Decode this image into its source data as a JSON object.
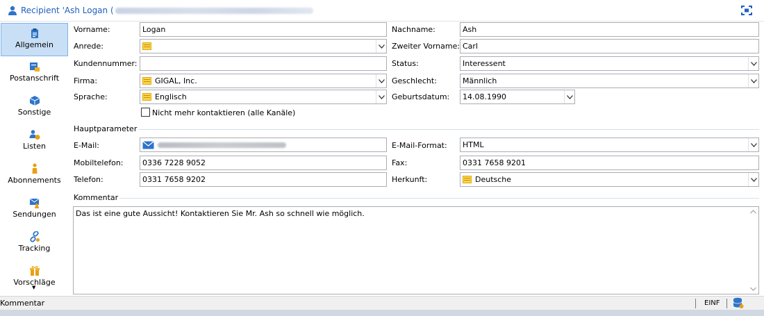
{
  "window": {
    "title": "Recipient 'Ash Logan ("
  },
  "sidebar": {
    "items": [
      {
        "label": "Allgemein",
        "icon": "clipboard-icon"
      },
      {
        "label": "Postanschrift",
        "icon": "mailbox-icon"
      },
      {
        "label": "Sonstige",
        "icon": "cube-icon"
      },
      {
        "label": "Listen",
        "icon": "people-list-icon"
      },
      {
        "label": "Abonnements",
        "icon": "subscriber-icon"
      },
      {
        "label": "Sendungen",
        "icon": "envelope-person-icon"
      },
      {
        "label": "Tracking",
        "icon": "link-chain-icon"
      },
      {
        "label": "Vorschläge",
        "icon": "gift-icon"
      }
    ],
    "active": "Allgemein"
  },
  "form": {
    "vorname": {
      "label": "Vorname:",
      "value": "Logan"
    },
    "nachname": {
      "label": "Nachname:",
      "value": "Ash"
    },
    "anrede": {
      "label": "Anrede:",
      "value": ""
    },
    "zweiter_vorname": {
      "label": "Zweiter Vorname:",
      "value": "Carl"
    },
    "kundennummer": {
      "label": "Kundennummer:",
      "value": ""
    },
    "status": {
      "label": "Status:",
      "value": "Interessent"
    },
    "firma": {
      "label": "Firma:",
      "value": "GIGAL, Inc."
    },
    "geschlecht": {
      "label": "Geschlecht:",
      "value": "Männlich"
    },
    "sprache": {
      "label": "Sprache:",
      "value": "Englisch"
    },
    "geburtsdatum": {
      "label": "Geburtsdatum:",
      "value": "14.08.1990"
    },
    "nicht_kontaktieren": {
      "label": "Nicht mehr kontaktieren (alle Kanäle)",
      "checked": false
    }
  },
  "hauptparameter": {
    "title": "Hauptparameter",
    "email": {
      "label": "E-Mail:"
    },
    "email_format": {
      "label": "E-Mail-Format:",
      "value": "HTML"
    },
    "mobiltelefon": {
      "label": "Mobiltelefon:",
      "value": "0336 7228 9052"
    },
    "fax": {
      "label": "Fax:",
      "value": "0331 7658 9201"
    },
    "telefon": {
      "label": "Telefon:",
      "value": "0331 7658 9202"
    },
    "herkunft": {
      "label": "Herkunft:",
      "value": "Deutsche"
    }
  },
  "kommentar": {
    "title": "Kommentar",
    "text": "Das ist eine gute Aussicht! Kontaktieren Sie Mr. Ash so schnell wie möglich."
  },
  "statusbar": {
    "left": "Kommentar",
    "mode": "EINF"
  },
  "colors": {
    "accent": "#1f5fbf",
    "active_nav_bg": "#c8dff5",
    "active_nav_border": "#7eb4ea",
    "link_icon": "#e8b410"
  }
}
